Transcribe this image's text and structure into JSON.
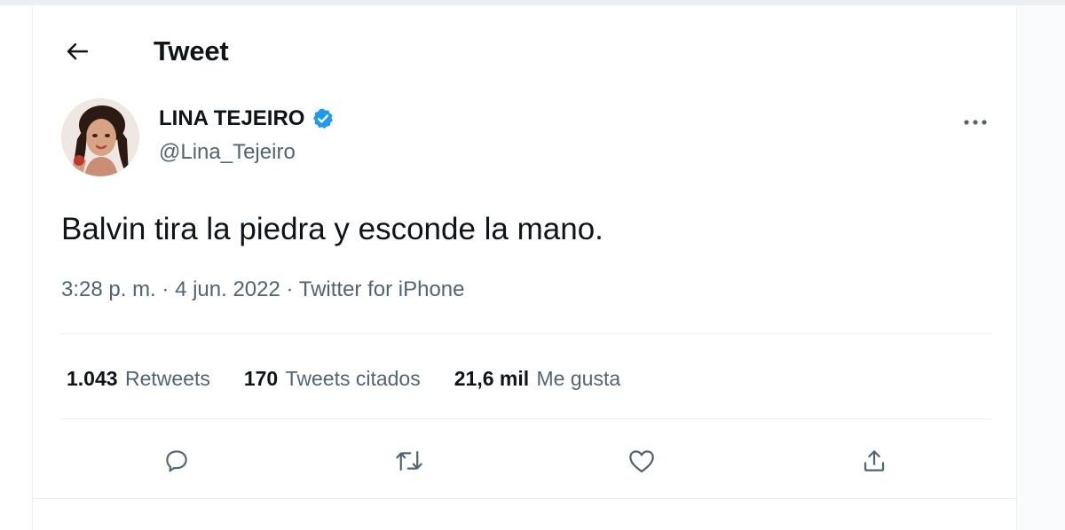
{
  "header": {
    "title": "Tweet",
    "back_icon": "arrow-left-icon"
  },
  "author": {
    "display_name": "LINA TEJEIRO",
    "handle": "@Lina_Tejeiro",
    "verified_icon": "verified-badge-icon",
    "verified_color": "#1d9bf0"
  },
  "tweet": {
    "text": "Balvin tira la piedra y esconde la mano.",
    "time": "3:28 p. m.",
    "separator_1": " · ",
    "date": "4 jun. 2022",
    "separator_2": " · ",
    "source": "Twitter for iPhone"
  },
  "stats": [
    {
      "count": "1.043",
      "label": "Retweets"
    },
    {
      "count": "170",
      "label": "Tweets citados"
    },
    {
      "count": "21,6 mil",
      "label": "Me gusta"
    }
  ],
  "actions": [
    {
      "icon": "reply-icon"
    },
    {
      "icon": "retweet-icon"
    },
    {
      "icon": "like-icon"
    },
    {
      "icon": "share-icon"
    }
  ],
  "colors": {
    "text_primary": "#0f1419",
    "text_secondary": "#536471",
    "accent": "#1d9bf0"
  }
}
